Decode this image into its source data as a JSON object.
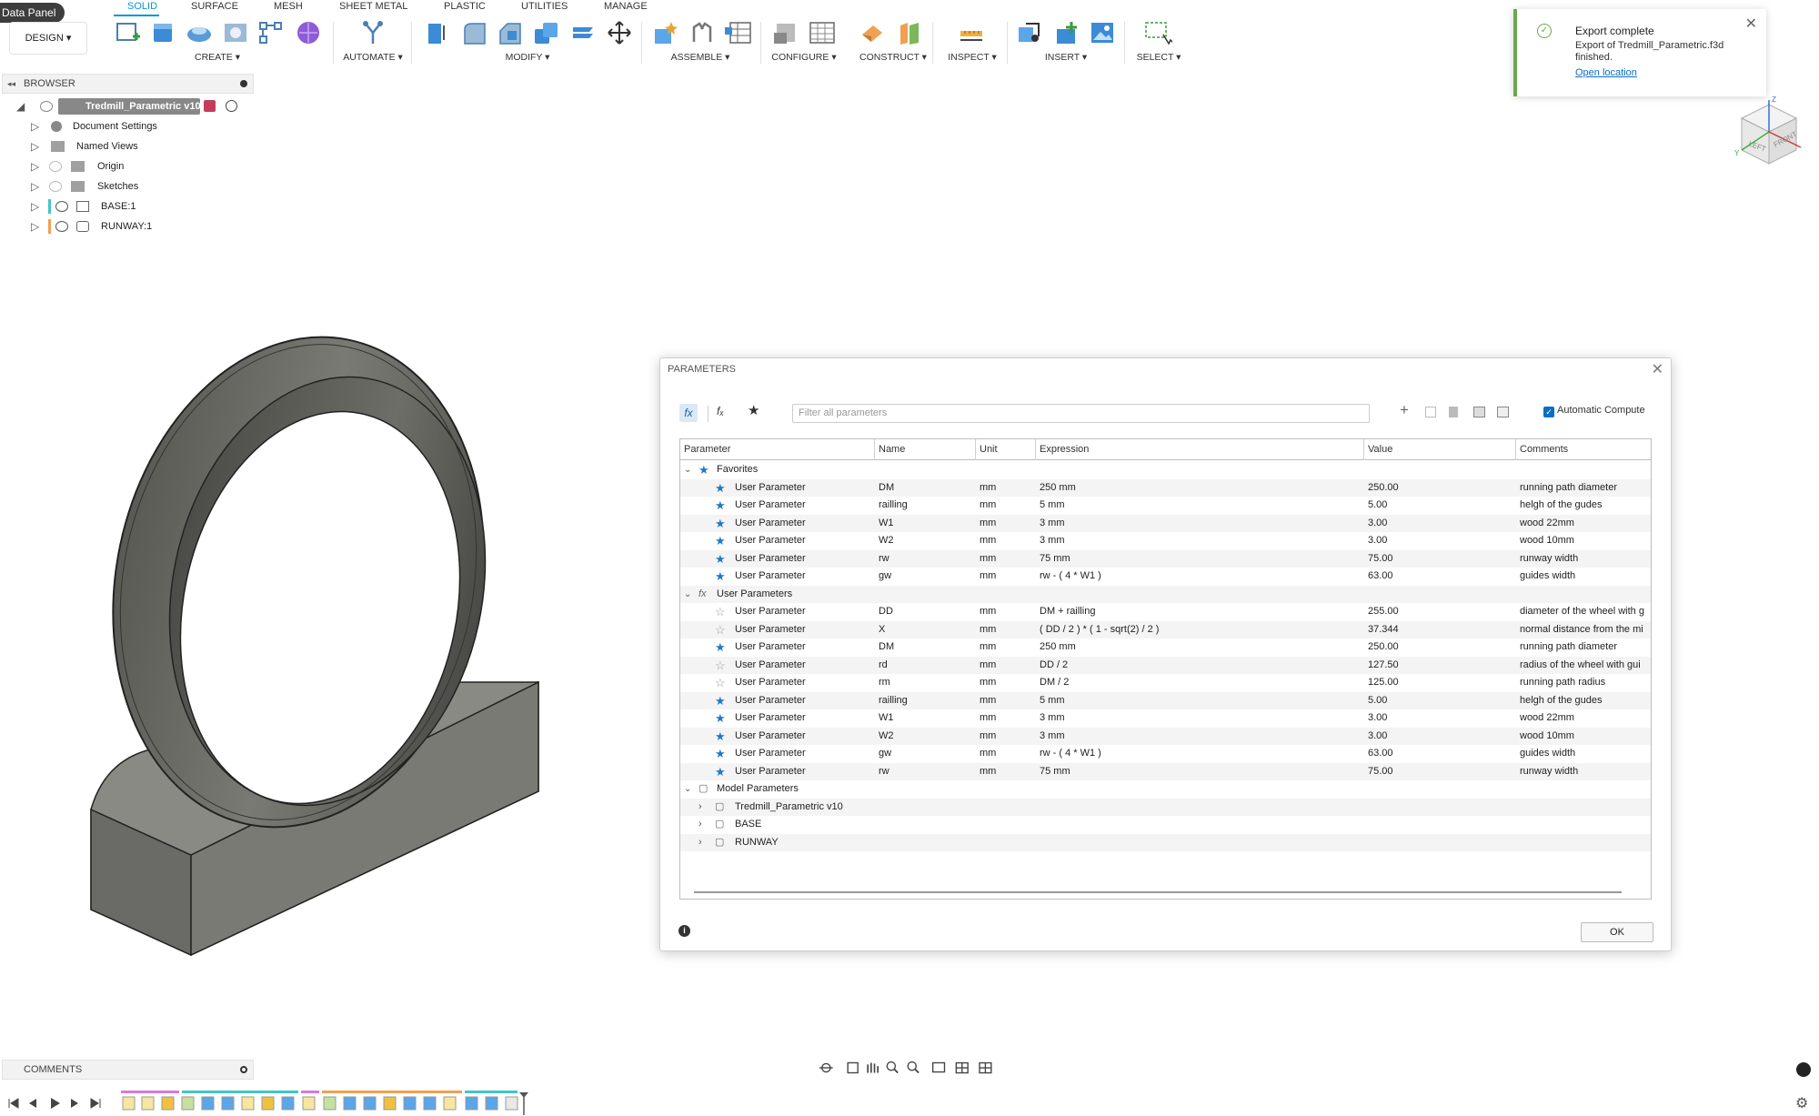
{
  "app": {
    "data_panel": "Data Panel",
    "workspace": "DESIGN ▾"
  },
  "tabs": [
    "SOLID",
    "SURFACE",
    "MESH",
    "SHEET METAL",
    "PLASTIC",
    "UTILITIES",
    "MANAGE"
  ],
  "toolbar_groups": [
    "CREATE ▾",
    "AUTOMATE ▾",
    "MODIFY ▾",
    "ASSEMBLE ▾",
    "CONFIGURE ▾",
    "CONSTRUCT ▾",
    "INSPECT ▾",
    "INSERT ▾",
    "SELECT ▾"
  ],
  "browser": {
    "title": "BROWSER",
    "root": "Tredmill_Parametric v10",
    "items": [
      "Document Settings",
      "Named Views",
      "Origin",
      "Sketches",
      "BASE:1",
      "RUNWAY:1"
    ]
  },
  "toast": {
    "title": "Export complete",
    "message": "Export of Tredmill_Parametric.f3d finished.",
    "link": "Open location"
  },
  "viewcube": {
    "front": "FRONT",
    "left": "LEFT",
    "axis_y": "Y",
    "axis_z": "Z"
  },
  "dialog": {
    "title": "PARAMETERS",
    "filter_placeholder": "Filter all parameters",
    "auto_compute": "Automatic Compute",
    "columns": [
      "Parameter",
      "Name",
      "Unit",
      "Expression",
      "Value",
      "Comments"
    ],
    "ok": "OK",
    "sections": {
      "favorites": "Favorites",
      "user": "User Parameters",
      "model": "Model Parameters"
    },
    "favorites": [
      {
        "type": "User Parameter",
        "name": "DM",
        "unit": "mm",
        "expr": "250 mm",
        "value": "250.00",
        "comment": "running path diameter",
        "fav": true
      },
      {
        "type": "User Parameter",
        "name": "railling",
        "unit": "mm",
        "expr": "5 mm",
        "value": "5.00",
        "comment": "helgh of the gudes",
        "fav": true
      },
      {
        "type": "User Parameter",
        "name": "W1",
        "unit": "mm",
        "expr": "3 mm",
        "value": "3.00",
        "comment": "wood 22mm",
        "fav": true
      },
      {
        "type": "User Parameter",
        "name": "W2",
        "unit": "mm",
        "expr": "3 mm",
        "value": "3.00",
        "comment": "wood 10mm",
        "fav": true
      },
      {
        "type": "User Parameter",
        "name": "rw",
        "unit": "mm",
        "expr": "75 mm",
        "value": "75.00",
        "comment": "runway width",
        "fav": true
      },
      {
        "type": "User Parameter",
        "name": "gw",
        "unit": "mm",
        "expr": "rw - ( 4 * W1 )",
        "value": "63.00",
        "comment": "guides width",
        "fav": true
      }
    ],
    "user_params": [
      {
        "type": "User Parameter",
        "name": "DD",
        "unit": "mm",
        "expr": "DM + railling",
        "value": "255.00",
        "comment": "diameter of the wheel with g",
        "fav": false
      },
      {
        "type": "User Parameter",
        "name": "X",
        "unit": "mm",
        "expr": "( DD / 2 ) * ( 1 - sqrt(2) / 2 )",
        "value": "37.344",
        "comment": "normal distance from the mi",
        "fav": false
      },
      {
        "type": "User Parameter",
        "name": "DM",
        "unit": "mm",
        "expr": "250 mm",
        "value": "250.00",
        "comment": "running path diameter",
        "fav": true
      },
      {
        "type": "User Parameter",
        "name": "rd",
        "unit": "mm",
        "expr": "DD / 2",
        "value": "127.50",
        "comment": "radius of the wheel with gui",
        "fav": false
      },
      {
        "type": "User Parameter",
        "name": "rm",
        "unit": "mm",
        "expr": "DM / 2",
        "value": "125.00",
        "comment": "running path radius",
        "fav": false
      },
      {
        "type": "User Parameter",
        "name": "railling",
        "unit": "mm",
        "expr": "5 mm",
        "value": "5.00",
        "comment": "helgh of the gudes",
        "fav": true
      },
      {
        "type": "User Parameter",
        "name": "W1",
        "unit": "mm",
        "expr": "3 mm",
        "value": "3.00",
        "comment": "wood 22mm",
        "fav": true
      },
      {
        "type": "User Parameter",
        "name": "W2",
        "unit": "mm",
        "expr": "3 mm",
        "value": "3.00",
        "comment": "wood 10mm",
        "fav": true
      },
      {
        "type": "User Parameter",
        "name": "gw",
        "unit": "mm",
        "expr": "rw - ( 4 * W1 )",
        "value": "63.00",
        "comment": "guides width",
        "fav": true
      },
      {
        "type": "User Parameter",
        "name": "rw",
        "unit": "mm",
        "expr": "75 mm",
        "value": "75.00",
        "comment": "runway width",
        "fav": true
      }
    ],
    "model_children": [
      "Tredmill_Parametric v10",
      "BASE",
      "RUNWAY"
    ]
  },
  "comments_panel": "COMMENTS",
  "colors": {
    "accent": "#0696d7",
    "toast_border": "#6aa84f",
    "star": "#1f78c8",
    "base": "#43c6c6",
    "runway": "#f0a050"
  }
}
